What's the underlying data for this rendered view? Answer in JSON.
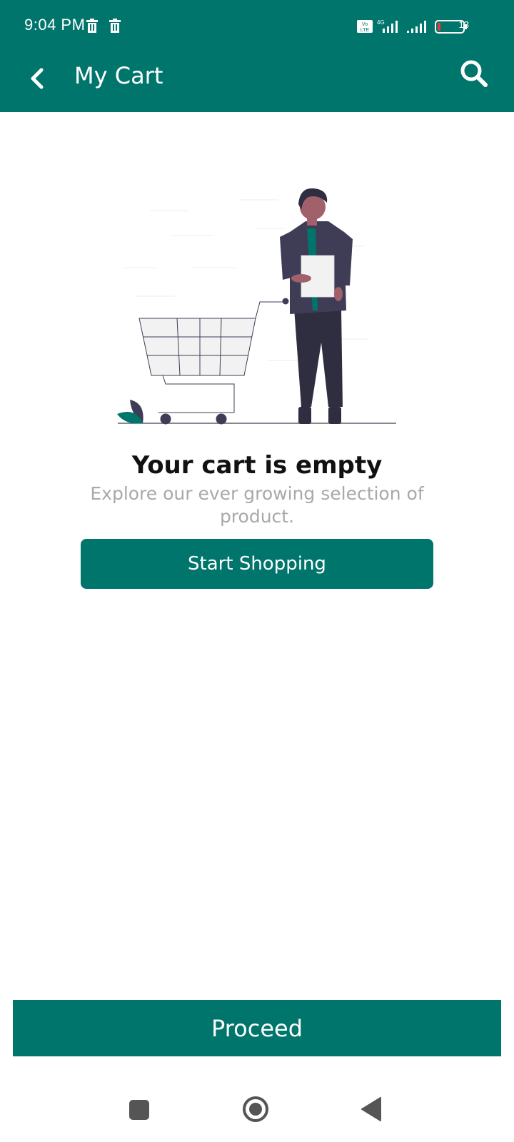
{
  "status_bar": {
    "time": "9:04 PM",
    "icons": [
      "trash-icon",
      "trash-icon",
      "volte-icon",
      "4g-icon",
      "signal-icon",
      "signal-icon"
    ],
    "battery": "13"
  },
  "app_bar": {
    "title": "My Cart",
    "back_icon": "chevron-left-icon",
    "search_icon": "search-icon"
  },
  "empty_state": {
    "title": "Your cart is empty",
    "subtitle": "Explore our ever growing selection of product.",
    "button_label": "Start Shopping"
  },
  "footer": {
    "proceed_label": "Proceed"
  },
  "nav_bar": {
    "items": [
      "recents-square-icon",
      "home-circle-icon",
      "back-triangle-icon"
    ]
  },
  "colors": {
    "primary": "#00756c",
    "subtitle": "#a9a9a9",
    "figure_dark": "#3f3d56"
  }
}
